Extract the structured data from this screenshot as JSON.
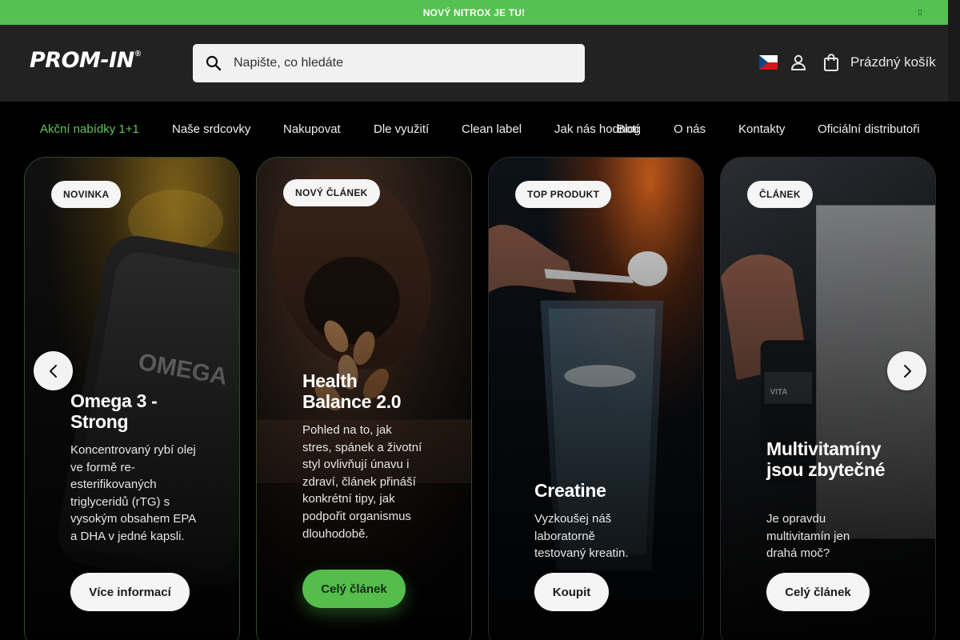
{
  "announcement": {
    "text": "NOVÝ NITROX JE TU!",
    "close_glyph": "▯"
  },
  "header": {
    "logo": "PROM-IN",
    "logo_mark": "®",
    "search_placeholder": "Napište, co hledáte",
    "language_flag": "flag-cz",
    "cart_label": "Prázdný košík"
  },
  "nav": {
    "items": [
      {
        "label": "Akční nabídky 1+1",
        "active": true
      },
      {
        "label": "Naše srdcovky"
      },
      {
        "label": "Nakupovat"
      },
      {
        "label": "Dle využití"
      },
      {
        "label": "Clean label"
      },
      {
        "label": "Jak nás hodnotí"
      },
      {
        "label": "Blog"
      },
      {
        "label": "O nás"
      },
      {
        "label": "Kontakty"
      },
      {
        "label": "Oficiální distributoři"
      }
    ]
  },
  "cards": [
    {
      "badge": "NOVINKA",
      "title": "Omega 3 - Strong",
      "description": "Koncentrovaný rybí olej ve formě re-esterifikovaných triglyceridů (rTG) s vysokým obsahem EPA a DHA v jedné kapsli.",
      "button": "Více informací"
    },
    {
      "badge": "NOVÝ ČLÁNEK",
      "title": "Health Balance 2.0",
      "description": "Pohled na to, jak stres, spánek a životní styl ovlivňují únavu i zdraví, článek přináší konkrétní tipy, jak podpořit organismus dlouhodobě.",
      "button": "Celý článek"
    },
    {
      "badge": "TOP PRODUKT",
      "title": "Creatine",
      "description": "Vyzkoušej náš laboratorně testovaný kreatin.",
      "button": "Koupit"
    },
    {
      "badge": "ČLÁNEK",
      "title": "Multivitamíny jsou zbytečné",
      "description": "Je opravdu multivitamín jen drahá moč?",
      "button": "Celý článek"
    }
  ],
  "colors": {
    "accent": "#55c150",
    "header_bg": "#222222",
    "nav_bg": "#000000"
  },
  "icons": [
    "search-icon",
    "user-icon",
    "shopping-bag-icon",
    "chevron-left-icon",
    "chevron-right-icon"
  ]
}
